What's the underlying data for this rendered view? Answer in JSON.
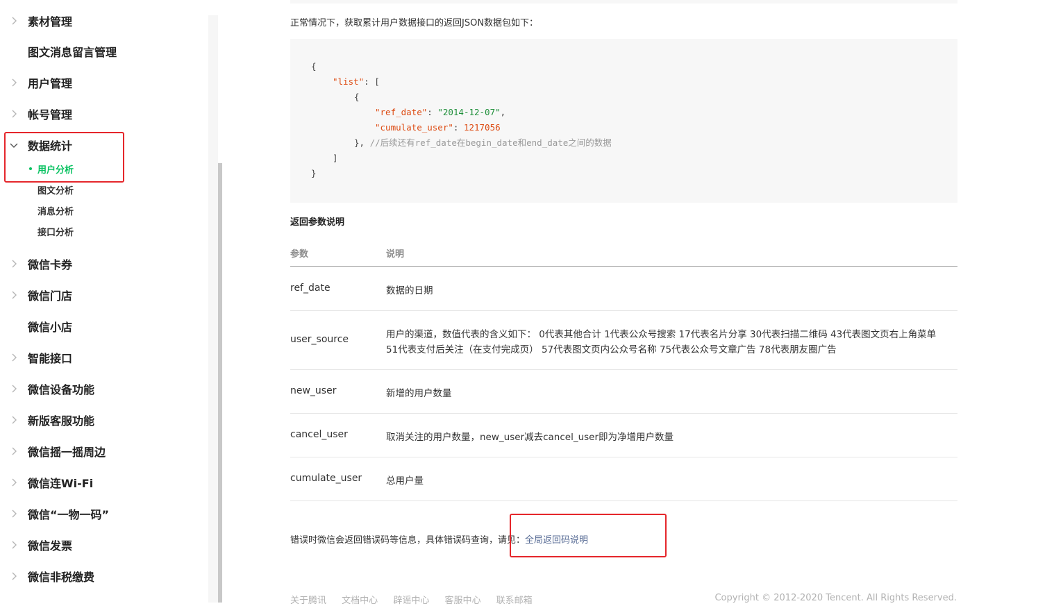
{
  "sidebar": {
    "items": [
      {
        "label": "素材管理",
        "has_chevron": true
      },
      {
        "label": "图文消息留言管理",
        "has_chevron": false
      },
      {
        "label": "用户管理",
        "has_chevron": true
      },
      {
        "label": "帐号管理",
        "has_chevron": true
      },
      {
        "label": "数据统计",
        "has_chevron": true,
        "expanded": true
      },
      {
        "label": "微信卡券",
        "has_chevron": true
      },
      {
        "label": "微信门店",
        "has_chevron": true
      },
      {
        "label": "微信小店",
        "has_chevron": false
      },
      {
        "label": "智能接口",
        "has_chevron": true
      },
      {
        "label": "微信设备功能",
        "has_chevron": true
      },
      {
        "label": "新版客服功能",
        "has_chevron": true
      },
      {
        "label": "微信摇一摇周边",
        "has_chevron": true
      },
      {
        "label": "微信连Wi-Fi",
        "has_chevron": true
      },
      {
        "label": "微信“一物一码”",
        "has_chevron": true
      },
      {
        "label": "微信发票",
        "has_chevron": true
      },
      {
        "label": "微信非税缴费",
        "has_chevron": true
      }
    ],
    "subitems": [
      {
        "label": "用户分析",
        "active": true
      },
      {
        "label": "图文分析",
        "active": false
      },
      {
        "label": "消息分析",
        "active": false
      },
      {
        "label": "接口分析",
        "active": false
      }
    ]
  },
  "main": {
    "intro": "正常情况下，获取累计用户数据接口的返回JSON数据包如下：",
    "code": {
      "open_brace": "{",
      "list_key": "\"list\"",
      "list_open": ": [",
      "inner_open": "{",
      "ref_date_key": "\"ref_date\"",
      "ref_date_val": "\"2014-12-07\"",
      "cumulate_key": "\"cumulate_user\"",
      "cumulate_val": "1217056",
      "inner_close": "},",
      "comment": "//后续还有ref_date在begin_date和end_date之间的数据",
      "list_close": "]",
      "close_brace": "}"
    },
    "section_title": "返回参数说明",
    "table": {
      "headers": [
        "参数",
        "说明"
      ],
      "rows": [
        {
          "param": "ref_date",
          "desc": [
            "数据的日期"
          ]
        },
        {
          "param": "user_source",
          "desc": [
            "用户的渠道，数值代表的含义如下： 0代表其他合计 1代表公众号搜索 17代表名片分享 30代表扫描二维码 43代表图文页右上角菜单",
            "51代表支付后关注（在支付完成页） 57代表图文页内公众号名称 75代表公众号文章广告 78代表朋友圈广告"
          ]
        },
        {
          "param": "new_user",
          "desc": [
            "新增的用户数量"
          ]
        },
        {
          "param": "cancel_user",
          "desc": [
            "取消关注的用户数量，new_user减去cancel_user即为净增用户数量"
          ]
        },
        {
          "param": "cumulate_user",
          "desc": [
            "总用户量"
          ]
        }
      ]
    },
    "error_text": "错误时微信会返回错误码等信息，具体错误码查询，请见：",
    "error_link": "全局返回码说明"
  },
  "footer": {
    "links": [
      "关于腾讯",
      "文档中心",
      "辟谣中心",
      "客服中心",
      "联系邮箱"
    ],
    "copyright": "Copyright © 2012-2020 Tencent. All Rights Reserved."
  },
  "colors": {
    "accent_green": "#07c160",
    "highlight_red": "#e5262b",
    "link_blue": "#576b95"
  }
}
